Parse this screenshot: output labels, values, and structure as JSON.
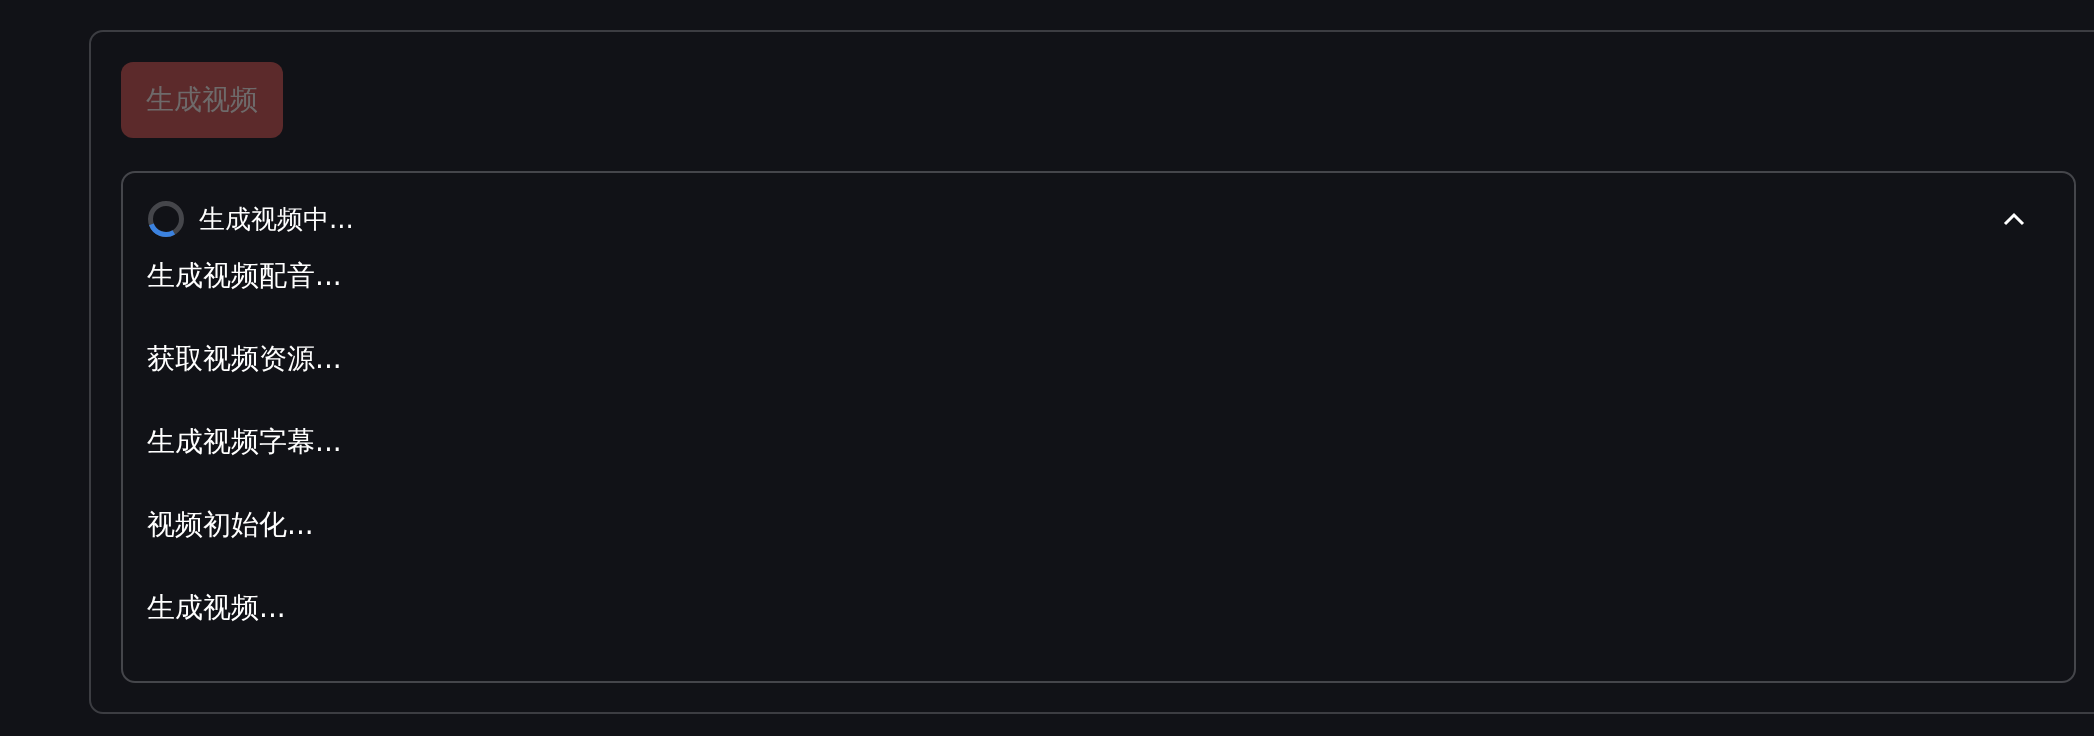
{
  "button": {
    "label": "生成视频",
    "disabled": true
  },
  "progress": {
    "label": "生成视频中...",
    "loading": true,
    "expanded": true,
    "steps": [
      "生成视频配音...",
      "获取视频资源...",
      "生成视频字幕...",
      "视频初始化...",
      "生成视频..."
    ]
  }
}
